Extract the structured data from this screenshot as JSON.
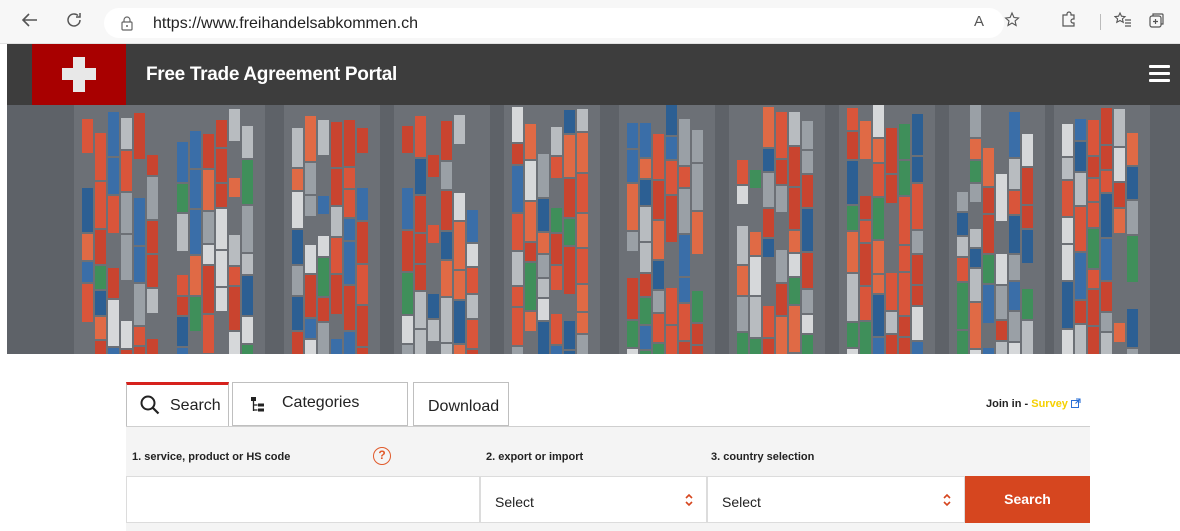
{
  "browser": {
    "url": "https://www.freihandelsabkommen.ch",
    "icons": [
      "back-arrow-icon",
      "reload-icon",
      "lock-icon",
      "read-aloud-icon",
      "favorite-add-icon",
      "extensions-icon",
      "favorites-icon",
      "collections-icon"
    ],
    "read_aloud_label": "A",
    "refresh_glyph": "C"
  },
  "site": {
    "title": "Free Trade Agreement Portal",
    "brand_color": "#a80000",
    "header_color": "#3d3d3d"
  },
  "tabs": [
    {
      "label": "Search",
      "icon": "search-icon",
      "active": true
    },
    {
      "label": "Categories",
      "icon": "tree-icon",
      "active": false
    },
    {
      "label": "Download",
      "icon": "",
      "active": false
    }
  ],
  "survey": {
    "prefix": "Join in - ",
    "link": "Survey",
    "link_color": "#f5d000"
  },
  "form": {
    "field1_label": "1. service, product or HS code",
    "field1_value": "",
    "field2_label": "2. export or import",
    "field2_value": "Select",
    "field3_label": "3. country selection",
    "field3_value": "Select",
    "help_glyph": "?",
    "search_button": "Search",
    "accent_color": "#d6461f"
  }
}
